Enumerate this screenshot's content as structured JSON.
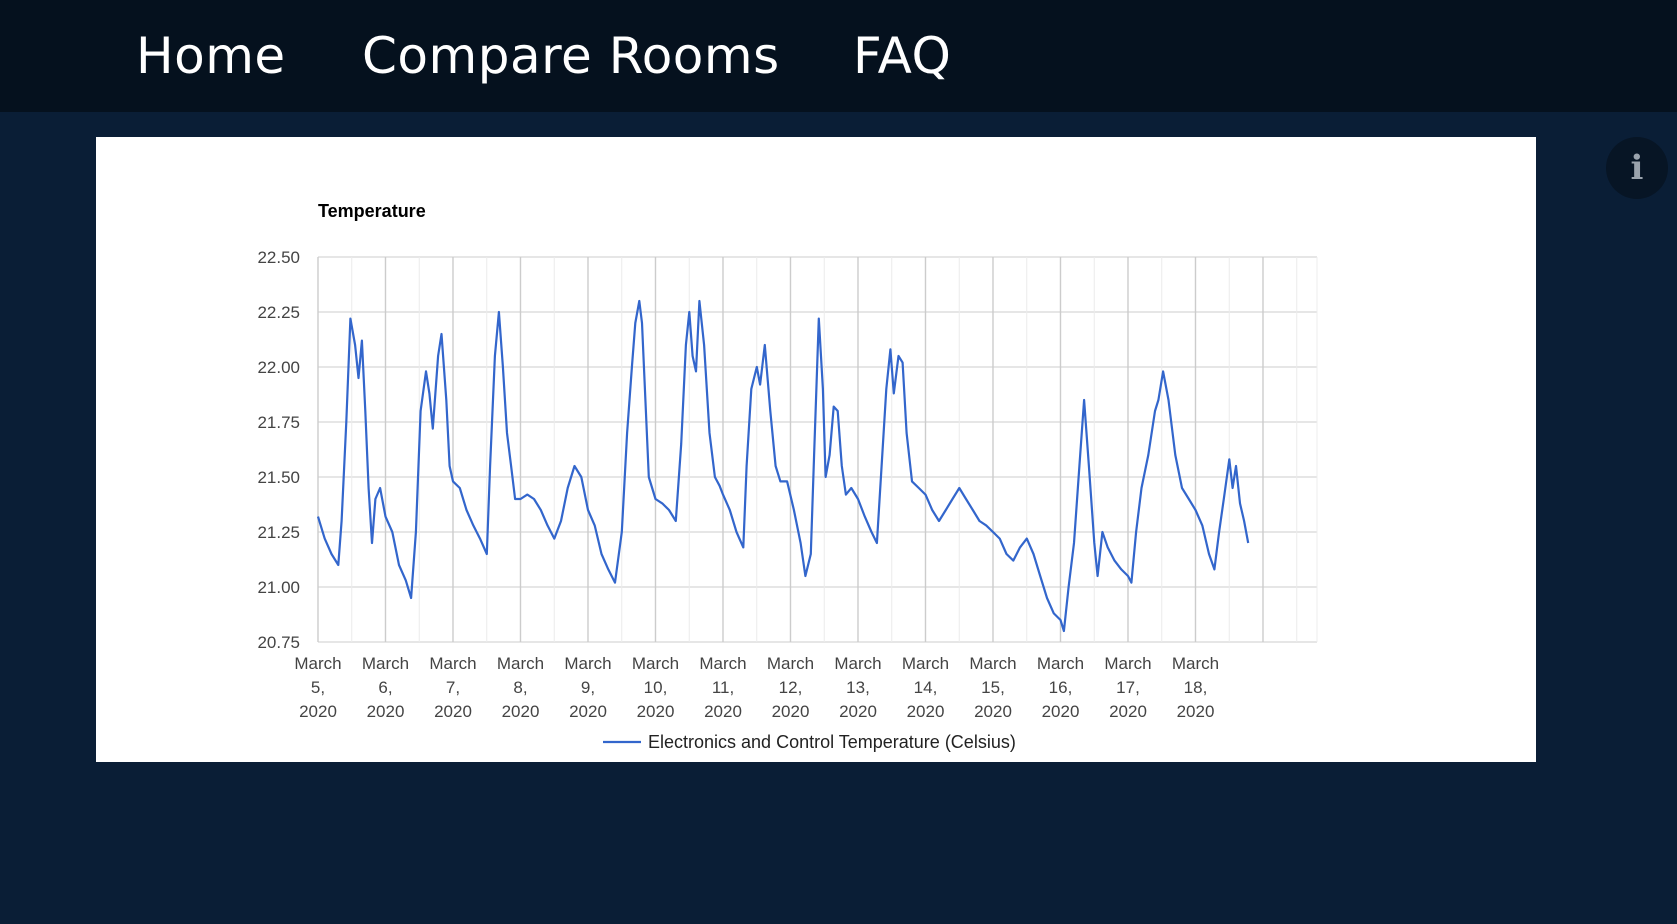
{
  "nav": {
    "home": "Home",
    "compare": "Compare Rooms",
    "faq": "FAQ"
  },
  "info_button": {
    "icon": "info-icon",
    "glyph": "i"
  },
  "colors": {
    "nav_bg": "#05111e",
    "page_bg": "#0a1e36",
    "series": "#3366cc",
    "grid": "#cccccc"
  },
  "chart_data": {
    "type": "line",
    "title": "Temperature",
    "ylim": [
      20.75,
      22.5
    ],
    "yticks": [
      "22.50",
      "22.25",
      "22.00",
      "21.75",
      "21.50",
      "21.25",
      "21.00",
      "20.75"
    ],
    "xlim": [
      5,
      19.8
    ],
    "xticks": [
      [
        "March",
        "5,",
        "2020"
      ],
      [
        "March",
        "6,",
        "2020"
      ],
      [
        "March",
        "7,",
        "2020"
      ],
      [
        "March",
        "8,",
        "2020"
      ],
      [
        "March",
        "9,",
        "2020"
      ],
      [
        "March",
        "10,",
        "2020"
      ],
      [
        "March",
        "11,",
        "2020"
      ],
      [
        "March",
        "12,",
        "2020"
      ],
      [
        "March",
        "13,",
        "2020"
      ],
      [
        "March",
        "14,",
        "2020"
      ],
      [
        "March",
        "15,",
        "2020"
      ],
      [
        "March",
        "16,",
        "2020"
      ],
      [
        "March",
        "17,",
        "2020"
      ],
      [
        "March",
        "18,",
        "2020"
      ]
    ],
    "grid": true,
    "legend_position": "bottom",
    "series": [
      {
        "name": "Electronics and Control Temperature (Celsius)",
        "points": [
          [
            5.0,
            21.32
          ],
          [
            5.1,
            21.22
          ],
          [
            5.2,
            21.15
          ],
          [
            5.3,
            21.1
          ],
          [
            5.35,
            21.3
          ],
          [
            5.42,
            21.75
          ],
          [
            5.48,
            22.22
          ],
          [
            5.55,
            22.1
          ],
          [
            5.6,
            21.95
          ],
          [
            5.65,
            22.12
          ],
          [
            5.7,
            21.8
          ],
          [
            5.75,
            21.45
          ],
          [
            5.8,
            21.2
          ],
          [
            5.85,
            21.4
          ],
          [
            5.92,
            21.45
          ],
          [
            6.0,
            21.32
          ],
          [
            6.1,
            21.25
          ],
          [
            6.2,
            21.1
          ],
          [
            6.3,
            21.03
          ],
          [
            6.38,
            20.95
          ],
          [
            6.45,
            21.25
          ],
          [
            6.52,
            21.8
          ],
          [
            6.6,
            21.98
          ],
          [
            6.65,
            21.88
          ],
          [
            6.7,
            21.72
          ],
          [
            6.78,
            22.05
          ],
          [
            6.83,
            22.15
          ],
          [
            6.9,
            21.85
          ],
          [
            6.95,
            21.55
          ],
          [
            7.0,
            21.48
          ],
          [
            7.1,
            21.45
          ],
          [
            7.2,
            21.35
          ],
          [
            7.3,
            21.28
          ],
          [
            7.4,
            21.22
          ],
          [
            7.5,
            21.15
          ],
          [
            7.55,
            21.55
          ],
          [
            7.62,
            22.05
          ],
          [
            7.68,
            22.25
          ],
          [
            7.74,
            22.0
          ],
          [
            7.8,
            21.7
          ],
          [
            7.86,
            21.55
          ],
          [
            7.92,
            21.4
          ],
          [
            8.0,
            21.4
          ],
          [
            8.1,
            21.42
          ],
          [
            8.2,
            21.4
          ],
          [
            8.3,
            21.35
          ],
          [
            8.4,
            21.28
          ],
          [
            8.5,
            21.22
          ],
          [
            8.6,
            21.3
          ],
          [
            8.7,
            21.45
          ],
          [
            8.8,
            21.55
          ],
          [
            8.9,
            21.5
          ],
          [
            9.0,
            21.35
          ],
          [
            9.1,
            21.28
          ],
          [
            9.2,
            21.15
          ],
          [
            9.3,
            21.08
          ],
          [
            9.4,
            21.02
          ],
          [
            9.5,
            21.25
          ],
          [
            9.58,
            21.7
          ],
          [
            9.65,
            22.0
          ],
          [
            9.7,
            22.2
          ],
          [
            9.76,
            22.3
          ],
          [
            9.8,
            22.2
          ],
          [
            9.85,
            21.85
          ],
          [
            9.9,
            21.5
          ],
          [
            10.0,
            21.4
          ],
          [
            10.1,
            21.38
          ],
          [
            10.2,
            21.35
          ],
          [
            10.3,
            21.3
          ],
          [
            10.38,
            21.65
          ],
          [
            10.45,
            22.1
          ],
          [
            10.5,
            22.25
          ],
          [
            10.55,
            22.05
          ],
          [
            10.6,
            21.98
          ],
          [
            10.65,
            22.3
          ],
          [
            10.72,
            22.1
          ],
          [
            10.8,
            21.7
          ],
          [
            10.88,
            21.5
          ],
          [
            10.95,
            21.46
          ],
          [
            11.0,
            21.42
          ],
          [
            11.1,
            21.35
          ],
          [
            11.2,
            21.25
          ],
          [
            11.3,
            21.18
          ],
          [
            11.35,
            21.55
          ],
          [
            11.42,
            21.9
          ],
          [
            11.5,
            22.0
          ],
          [
            11.55,
            21.92
          ],
          [
            11.62,
            22.1
          ],
          [
            11.7,
            21.8
          ],
          [
            11.78,
            21.55
          ],
          [
            11.85,
            21.48
          ],
          [
            11.95,
            21.48
          ],
          [
            12.05,
            21.35
          ],
          [
            12.15,
            21.2
          ],
          [
            12.22,
            21.05
          ],
          [
            12.3,
            21.15
          ],
          [
            12.35,
            21.6
          ],
          [
            12.42,
            22.22
          ],
          [
            12.48,
            21.9
          ],
          [
            12.52,
            21.5
          ],
          [
            12.58,
            21.6
          ],
          [
            12.64,
            21.82
          ],
          [
            12.7,
            21.8
          ],
          [
            12.76,
            21.55
          ],
          [
            12.82,
            21.42
          ],
          [
            12.9,
            21.45
          ],
          [
            13.0,
            21.4
          ],
          [
            13.1,
            21.32
          ],
          [
            13.2,
            21.25
          ],
          [
            13.28,
            21.2
          ],
          [
            13.35,
            21.55
          ],
          [
            13.42,
            21.9
          ],
          [
            13.48,
            22.08
          ],
          [
            13.53,
            21.88
          ],
          [
            13.6,
            22.05
          ],
          [
            13.66,
            22.02
          ],
          [
            13.72,
            21.7
          ],
          [
            13.8,
            21.48
          ],
          [
            13.9,
            21.45
          ],
          [
            14.0,
            21.42
          ],
          [
            14.1,
            21.35
          ],
          [
            14.2,
            21.3
          ],
          [
            14.3,
            21.35
          ],
          [
            14.4,
            21.4
          ],
          [
            14.5,
            21.45
          ],
          [
            14.6,
            21.4
          ],
          [
            14.7,
            21.35
          ],
          [
            14.8,
            21.3
          ],
          [
            14.9,
            21.28
          ],
          [
            15.0,
            21.25
          ],
          [
            15.1,
            21.22
          ],
          [
            15.2,
            21.15
          ],
          [
            15.3,
            21.12
          ],
          [
            15.4,
            21.18
          ],
          [
            15.5,
            21.22
          ],
          [
            15.6,
            21.15
          ],
          [
            15.7,
            21.05
          ],
          [
            15.8,
            20.95
          ],
          [
            15.9,
            20.88
          ],
          [
            16.0,
            20.85
          ],
          [
            16.05,
            20.8
          ],
          [
            16.12,
            21.0
          ],
          [
            16.2,
            21.2
          ],
          [
            16.28,
            21.55
          ],
          [
            16.35,
            21.85
          ],
          [
            16.42,
            21.55
          ],
          [
            16.5,
            21.2
          ],
          [
            16.55,
            21.05
          ],
          [
            16.62,
            21.25
          ],
          [
            16.7,
            21.18
          ],
          [
            16.8,
            21.12
          ],
          [
            16.9,
            21.08
          ],
          [
            17.0,
            21.05
          ],
          [
            17.05,
            21.02
          ],
          [
            17.12,
            21.25
          ],
          [
            17.2,
            21.45
          ],
          [
            17.3,
            21.6
          ],
          [
            17.4,
            21.8
          ],
          [
            17.45,
            21.85
          ],
          [
            17.52,
            21.98
          ],
          [
            17.6,
            21.85
          ],
          [
            17.7,
            21.6
          ],
          [
            17.8,
            21.45
          ],
          [
            17.9,
            21.4
          ],
          [
            18.0,
            21.35
          ],
          [
            18.1,
            21.28
          ],
          [
            18.2,
            21.15
          ],
          [
            18.28,
            21.08
          ],
          [
            18.35,
            21.25
          ],
          [
            18.42,
            21.4
          ],
          [
            18.5,
            21.58
          ],
          [
            18.55,
            21.45
          ],
          [
            18.6,
            21.55
          ],
          [
            18.66,
            21.38
          ],
          [
            18.72,
            21.3
          ],
          [
            18.78,
            21.2
          ]
        ]
      }
    ]
  }
}
